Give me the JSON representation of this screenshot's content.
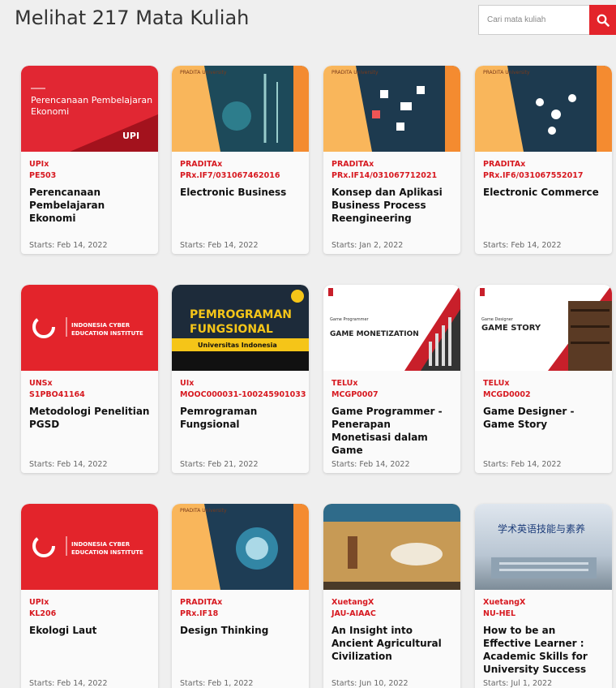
{
  "header": {
    "title": "Melihat 217 Mata Kuliah"
  },
  "search": {
    "placeholder": "Cari mata kuliah"
  },
  "courses": [
    {
      "org": "UPIx",
      "code": "PE503",
      "title": "Perencanaan Pembelajaran Ekonomi",
      "starts": "Starts: Feb 14, 2022",
      "thumb_text": "Perencanaan Pembelajaran Ekonomi",
      "thumb_logo": "UPI"
    },
    {
      "org": "PRADITAx",
      "code": "PRx.IF7/031067462016",
      "title": "Electronic Business",
      "starts": "Starts: Feb 14, 2022",
      "thumb_logo": "PRADITA University"
    },
    {
      "org": "PRADITAx",
      "code": "PRx.IF14/031067712021",
      "title": "Konsep dan Aplikasi Business Process Reengineering",
      "starts": "Starts: Jan 2, 2022",
      "thumb_logo": "PRADITA University"
    },
    {
      "org": "PRADITAx",
      "code": "PRx.IF6/031067552017",
      "title": "Electronic Commerce",
      "starts": "Starts: Feb 14, 2022",
      "thumb_logo": "PRADITA University"
    },
    {
      "org": "UNSx",
      "code": "S1PBO41164",
      "title": "Metodologi Penelitian PGSD",
      "starts": "Starts: Feb 14, 2022",
      "thumb_logo": "INDONESIA CYBER EDUCATION INSTITUTE"
    },
    {
      "org": "UIx",
      "code": "MOOC000031-100245901033",
      "title": "Pemrograman Fungsional",
      "starts": "Starts: Feb 21, 2022",
      "thumb_text": "PEMROGRAMAN FUNGSIONAL",
      "thumb_sub": "Universitas Indonesia"
    },
    {
      "org": "TELUx",
      "code": "MCGP0007",
      "title": "Game Programmer - Penerapan Monetisasi dalam Game",
      "starts": "Starts: Feb 14, 2022",
      "thumb_small": "Game Programmer",
      "thumb_text": "GAME MONETIZATION"
    },
    {
      "org": "TELUx",
      "code": "MCGD0002",
      "title": "Game Designer - Game Story",
      "starts": "Starts: Feb 14, 2022",
      "thumb_small": "Game Designer",
      "thumb_text": "GAME STORY"
    },
    {
      "org": "UPIx",
      "code": "KL206",
      "title": "Ekologi Laut",
      "starts": "Starts: Feb 14, 2022",
      "thumb_logo": "INDONESIA CYBER EDUCATION INSTITUTE"
    },
    {
      "org": "PRADITAx",
      "code": "PRx.IF18",
      "title": "Design Thinking",
      "starts": "Starts: Feb 1, 2022",
      "thumb_logo": "PRADITA University"
    },
    {
      "org": "XuetangX",
      "code": "JAU-AIAAC",
      "title": "An Insight into Ancient Agricultural Civilization",
      "starts": "Starts: Jun 10, 2022"
    },
    {
      "org": "XuetangX",
      "code": "NU-HEL",
      "title": "How to be an Effective Learner : Academic Skills for University Success",
      "starts": "Starts: Jul 1, 2022",
      "thumb_text": "学术英语技能与素养"
    }
  ],
  "colors": {
    "accent": "#d71920",
    "search_button": "#e3242b",
    "pradita_orange": "#f9b65b"
  },
  "icons": {
    "search_button": "search-icon"
  }
}
